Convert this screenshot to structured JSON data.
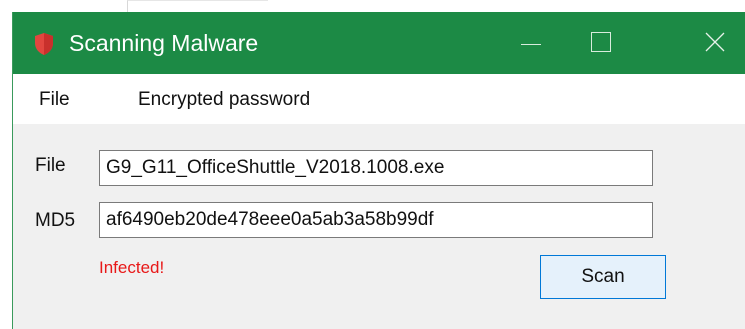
{
  "window": {
    "title": "Scanning Malware",
    "accent_color": "#1c8a45",
    "icon": "shield-icon"
  },
  "menu": {
    "items": [
      {
        "label": "File"
      },
      {
        "label": "Encrypted password"
      }
    ]
  },
  "form": {
    "file_label": "File",
    "file_value": "G9_G11_OfficeShuttle_V2018.1008.exe",
    "md5_label": "MD5",
    "md5_value": "af6490eb20de478eee0a5ab3a58b99df",
    "status_text": "Infected!",
    "status_color": "#e81818",
    "scan_label": "Scan"
  }
}
